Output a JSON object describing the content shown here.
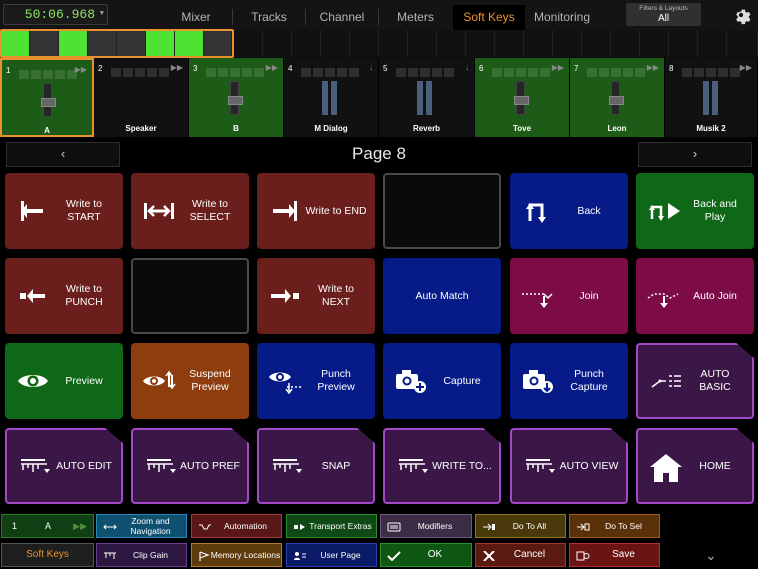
{
  "topbar": {
    "timecode": "50:06.968",
    "tabs": [
      {
        "label": "Mixer",
        "active": false
      },
      {
        "label": "Tracks",
        "active": false
      },
      {
        "label": "Channel",
        "active": false
      },
      {
        "label": "Meters",
        "active": false
      },
      {
        "label": "Soft Keys",
        "active": true
      },
      {
        "label": "Monitoring",
        "active": false
      }
    ],
    "filters_title": "Filters & Layouts",
    "filters_value": "All",
    "accent": "#e8912e"
  },
  "strips": [
    {
      "num": "1",
      "name": "A",
      "color": "#1c5c17",
      "selected": true
    },
    {
      "num": "2",
      "name": "Speaker",
      "color": "#111111",
      "selected": false
    },
    {
      "num": "3",
      "name": "B",
      "color": "#1c5c17",
      "selected": false
    },
    {
      "num": "4",
      "name": "M Dialog",
      "color": "#111111",
      "selected": false
    },
    {
      "num": "5",
      "name": "Reverb",
      "color": "#111111",
      "selected": false
    },
    {
      "num": "6",
      "name": "Tove",
      "color": "#1c5c17",
      "selected": false
    },
    {
      "num": "7",
      "name": "Leon",
      "color": "#1c5c17",
      "selected": false
    },
    {
      "num": "8",
      "name": "Musik 2",
      "color": "#111111",
      "selected": false
    }
  ],
  "page": {
    "label": "Page 8",
    "prev": "‹",
    "next": "›"
  },
  "keys": [
    {
      "label": "Write to START",
      "color": "red",
      "icon": "write-to-start-icon"
    },
    {
      "label": "Write to SELECT",
      "color": "red",
      "icon": "write-to-select-icon"
    },
    {
      "label": "Write to END",
      "color": "red",
      "icon": "write-to-end-icon"
    },
    {
      "label": "",
      "color": "empty",
      "icon": ""
    },
    {
      "label": "Back",
      "color": "blue",
      "icon": "back-icon"
    },
    {
      "label": "Back and Play",
      "color": "green",
      "icon": "back-and-play-icon"
    },
    {
      "label": "Write to PUNCH",
      "color": "red",
      "icon": "write-to-punch-icon"
    },
    {
      "label": "",
      "color": "empty",
      "icon": ""
    },
    {
      "label": "Write to NEXT",
      "color": "red",
      "icon": "write-to-next-icon"
    },
    {
      "label": "Auto Match",
      "color": "blue",
      "icon": ""
    },
    {
      "label": "Join",
      "color": "pink",
      "icon": "join-icon"
    },
    {
      "label": "Auto Join",
      "color": "pink",
      "icon": "auto-join-icon"
    },
    {
      "label": "Preview",
      "color": "green",
      "icon": "eye-icon"
    },
    {
      "label": "Suspend Preview",
      "color": "orange",
      "icon": "suspend-preview-icon"
    },
    {
      "label": "Punch Preview",
      "color": "blue",
      "icon": "punch-preview-icon"
    },
    {
      "label": "Capture",
      "color": "blue",
      "icon": "camera-add-icon"
    },
    {
      "label": "Punch Capture",
      "color": "blue",
      "icon": "camera-down-icon"
    },
    {
      "label": "AUTO BASIC",
      "color": "purple",
      "icon": "auto-basic-icon"
    },
    {
      "label": "AUTO EDIT",
      "color": "purple",
      "icon": "automation-icon"
    },
    {
      "label": "AUTO PREF",
      "color": "purple",
      "icon": "automation-icon"
    },
    {
      "label": "SNAP",
      "color": "purple",
      "icon": "automation-icon"
    },
    {
      "label": "WRITE TO...",
      "color": "purple",
      "icon": "automation-icon"
    },
    {
      "label": "AUTO VIEW",
      "color": "purple",
      "icon": "automation-icon"
    },
    {
      "label": "HOME",
      "color": "purple",
      "icon": "home-icon"
    }
  ],
  "bottom": {
    "row1": [
      {
        "label": "1",
        "label2": "A",
        "color": "#0f3f12",
        "border": "#2b7a25",
        "icon": "channel-icon"
      },
      {
        "label": "Zoom and Navigation",
        "color": "#0f4f6f",
        "border": "#2b86b3",
        "icon": "zoom-icon"
      },
      {
        "label": "Automation",
        "color": "#5a1717",
        "border": "#a23a3a",
        "icon": "automation-bank-icon"
      },
      {
        "label": "Transport Extras",
        "color": "#0f4a16",
        "border": "#2c8a34",
        "icon": "transport-icon"
      },
      {
        "label": "Modifiers",
        "color": "#3b2d46",
        "border": "#6d5880",
        "icon": "keyboard-icon"
      },
      {
        "label": "Do To All",
        "color": "#4a3a0b",
        "border": "#8d7324",
        "icon": "do-to-all-icon"
      },
      {
        "label": "Do To Sel",
        "color": "#5b3109",
        "border": "#9b5a1e",
        "icon": "do-to-sel-icon"
      }
    ],
    "row2": [
      {
        "label": "Soft Keys",
        "icon": ""
      },
      {
        "label": "Clip Gain",
        "color": "#2d1842",
        "border": "#6a3c90",
        "icon": "clip-gain-icon"
      },
      {
        "label": "Memory Locations",
        "color": "#5e3c0d",
        "border": "#b27b23",
        "icon": "memory-icon"
      },
      {
        "label": "User Page",
        "color": "#0b1a66",
        "border": "#2a3fb0",
        "icon": "user-page-icon"
      },
      {
        "label": "OK",
        "color": "#0d5713",
        "border": "#27922c",
        "icon": "check-icon"
      },
      {
        "label": "Cancel",
        "color": "#5a1a12",
        "border": "#a5362a",
        "icon": "x-icon"
      },
      {
        "label": "Save",
        "color": "#6a1414",
        "border": "#b03030",
        "icon": "save-icon"
      }
    ]
  }
}
